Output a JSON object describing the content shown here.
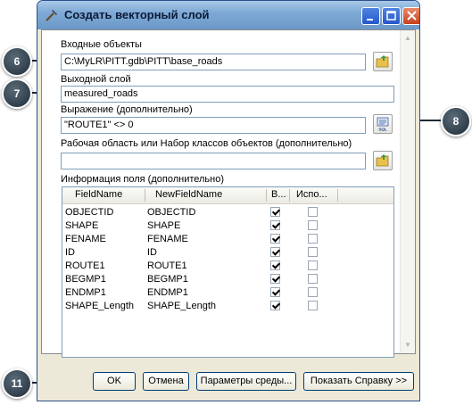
{
  "window": {
    "title": "Создать векторный слой"
  },
  "input_features": {
    "label": "Входные объекты",
    "value": "C:\\MyLR\\PITT.gdb\\PITT\\base_roads"
  },
  "output_layer": {
    "label": "Выходной слой",
    "value": "measured_roads"
  },
  "expression": {
    "label": "Выражение (дополнительно)",
    "value": "\"ROUTE1\" <> 0"
  },
  "workspace": {
    "label": "Рабочая область или Набор классов объектов (дополнительно)",
    "value": ""
  },
  "field_info": {
    "label": "Информация поля (дополнительно)",
    "headers": [
      "FieldName",
      "NewFieldName",
      "В...",
      "Испо..."
    ],
    "rows": [
      {
        "field": "OBJECTID",
        "new_field": "OBJECTID",
        "visible": true,
        "used": false
      },
      {
        "field": "SHAPE",
        "new_field": "SHAPE",
        "visible": true,
        "used": false
      },
      {
        "field": "FENAME",
        "new_field": "FENAME",
        "visible": true,
        "used": false
      },
      {
        "field": "ID",
        "new_field": "ID",
        "visible": true,
        "used": false
      },
      {
        "field": "ROUTE1",
        "new_field": "ROUTE1",
        "visible": true,
        "used": false
      },
      {
        "field": "BEGMP1",
        "new_field": "BEGMP1",
        "visible": true,
        "used": false
      },
      {
        "field": "ENDMP1",
        "new_field": "ENDMP1",
        "visible": true,
        "used": false
      },
      {
        "field": "SHAPE_Length",
        "new_field": "SHAPE_Length",
        "visible": true,
        "used": false
      }
    ]
  },
  "buttons": {
    "ok": "OK",
    "cancel": "Отмена",
    "env": "Параметры среды...",
    "help": "Показать Справку >>"
  },
  "callouts": [
    "6",
    "7",
    "8",
    "11"
  ],
  "colors": {
    "title_bar": "#7faad6",
    "close_button": "#c7411c",
    "callout": "#1e2c38"
  },
  "icons": [
    "hammer-icon",
    "browse-folder-icon",
    "sql-icon"
  ]
}
